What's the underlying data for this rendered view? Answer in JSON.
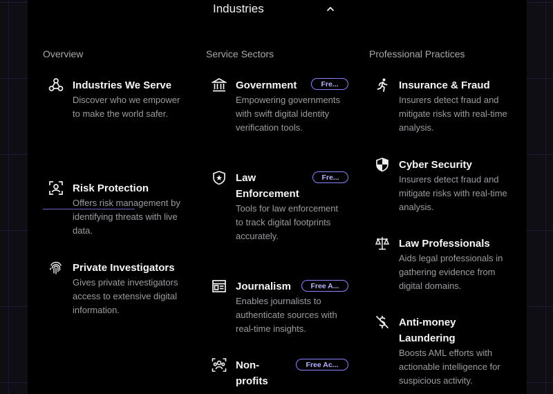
{
  "header": {
    "title": "Industries"
  },
  "columns": {
    "overview": {
      "heading": "Overview",
      "items": [
        {
          "icon": "network-icon",
          "title": "Industries We Serve",
          "desc": "Discover who we empower to make the world safer."
        },
        {
          "icon": "risk-scan-icon",
          "title": "Risk Protection",
          "desc": "Offers risk management by identifying threats with live data."
        },
        {
          "icon": "fingerprint-icon",
          "title": "Private Investigators",
          "desc": "Gives private investigators access to extensive digital information."
        }
      ]
    },
    "service": {
      "heading": "Service Sectors",
      "items": [
        {
          "icon": "government-building-icon",
          "title": "Government",
          "badge": "Fre...",
          "desc": "Empowering governments with swift digital identity verification tools."
        },
        {
          "icon": "police-badge-icon",
          "title": "Law Enforcement",
          "badge": "Fre...",
          "desc": "Tools for law enforcement to track digital footprints accurately."
        },
        {
          "icon": "newspaper-icon",
          "title": "Journalism",
          "badge": "Free A...",
          "desc": "Enables journalists to authenticate sources with real-time insights."
        },
        {
          "icon": "community-icon",
          "title": "Non-profits",
          "badge": "Free Ac..."
        }
      ]
    },
    "practices": {
      "heading": "Professional Practices",
      "items": [
        {
          "icon": "running-person-icon",
          "title": "Insurance & Fraud",
          "desc": "Insurers detect fraud and mitigate risks with real-time analysis."
        },
        {
          "icon": "shield-icon",
          "title": "Cyber Security",
          "desc": "Insurers detect fraud and mitigate risks with real-time analysis."
        },
        {
          "icon": "scales-icon",
          "title": "Law Professionals",
          "desc": "Aids legal professionals in gathering evidence from digital domains."
        },
        {
          "icon": "money-off-icon",
          "title": "Anti-money Laundering",
          "desc": "Boosts AML efforts with actionable intelligence for suspicious activity."
        }
      ]
    }
  }
}
